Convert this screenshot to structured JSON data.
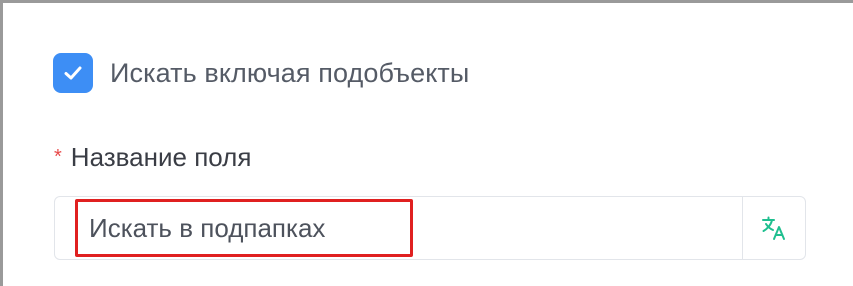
{
  "search_subobjects": {
    "checked": true,
    "label": "Искать включая подобъекты"
  },
  "field_name": {
    "required_mark": "*",
    "label": "Название поля",
    "value": "Искать в подпапках"
  },
  "colors": {
    "accent": "#3d8ef5",
    "required": "#e84a4a",
    "highlight": "#e02020",
    "translate_icon": "#1fbf8f"
  },
  "icons": {
    "checkbox": "check-icon",
    "translate": "translate-icon"
  }
}
